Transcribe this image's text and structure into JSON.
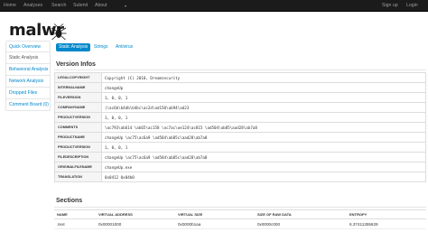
{
  "nav": {
    "brand": "Home",
    "items": [
      "Analyses",
      "Search",
      "Submit",
      "About"
    ],
    "right": [
      "Sign up",
      "Login"
    ]
  },
  "logo": {
    "text": "malwr",
    "icon": "bug-icon"
  },
  "sidebar": {
    "items": [
      {
        "label": "Quick Overview"
      },
      {
        "label": "Static Analysis"
      },
      {
        "label": "Behavioral Analysis"
      },
      {
        "label": "Network Analysis"
      },
      {
        "label": "Dropped Files"
      },
      {
        "label": "Comment Board (0)"
      }
    ]
  },
  "tabs": [
    "Static Analysis",
    "Strings",
    "Antivirus"
  ],
  "version_infos": {
    "title": "Version Infos",
    "rows": [
      {
        "key": "LEGALCOPYRIGHT",
        "value": "Copyright (C) 2010, Dreamsecurity"
      },
      {
        "key": "INTERNALNAME",
        "value": "changeUp"
      },
      {
        "key": "FILEVERSION",
        "value": "1, 0, 0, 1"
      },
      {
        "key": "COMPANYNAME",
        "value": "(\\ac6b\\b4db\\b4bc\\ac2d\\ad150\\ab94\\ad23"
      },
      {
        "key": "PRODUCTVERSION",
        "value": "1, 0, 0, 1"
      },
      {
        "key": "COMMENTS",
        "value": "\\ac793\\ab614 \\ab65\\ac158 \\ac7ac\\ae124\\ac815 \\ad504\\ab85\\aad28\\ab7a8"
      },
      {
        "key": "PRODUCTNAME",
        "value": "changeUp \\ac75\\ac6a9 \\ad504\\ab85c\\aad28\\ab7a8"
      },
      {
        "key": "PRODUCTVERSION",
        "value": "1, 0, 0, 1"
      },
      {
        "key": "FILEDESCRIPTION",
        "value": "changeUp \\ac75\\ac6a9 \\ad504\\ab85c\\aad28\\ab7a8"
      },
      {
        "key": "ORIGINALFILENAME",
        "value": "changeUp.exe"
      },
      {
        "key": "TRANSLATION",
        "value": "0x0412 0x04b0"
      }
    ]
  },
  "sections": {
    "title": "Sections",
    "headers": [
      "NAME",
      "VIRTUAL ADDRESS",
      "VIRTUAL SIZE",
      "SIZE OF RAW DATA",
      "ENTROPY"
    ],
    "rows": [
      [
        ".text",
        "0x00001000",
        "0x0000b1aa",
        "0x0000c000",
        "6.37411355629"
      ]
    ]
  },
  "colors": {
    "nav_bg": "#1b1b1b",
    "link": "#0088cc",
    "active_tab": "#0088cc"
  }
}
